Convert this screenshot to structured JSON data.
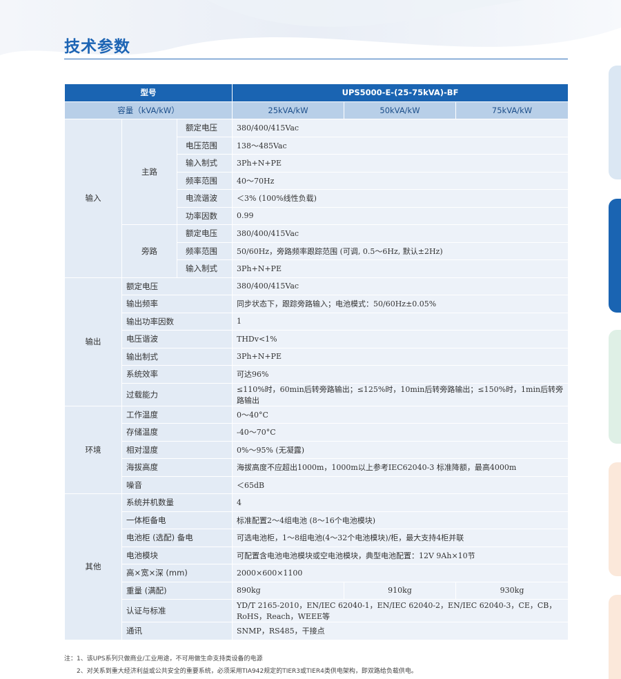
{
  "page_title": "技术参数",
  "table": {
    "header_model_label": "型号",
    "header_model_value": "UPS5000-E-(25-75kVA)-BF",
    "capacity_label": "容量（kVA/kW）",
    "capacities": [
      "25kVA/kW",
      "50kVA/kW",
      "75kVA/kW"
    ],
    "input": {
      "label": "输入",
      "main": {
        "label": "主路",
        "rows": [
          {
            "name": "额定电压",
            "value": "380/400/415Vac"
          },
          {
            "name": "电压范围",
            "value": "138～485Vac"
          },
          {
            "name": "输入制式",
            "value": "3Ph+N+PE"
          },
          {
            "name": "频率范围",
            "value": "40～70Hz"
          },
          {
            "name": "电流谐波",
            "value": "＜3% (100%线性负载)"
          },
          {
            "name": "功率因数",
            "value": "0.99"
          }
        ]
      },
      "bypass": {
        "label": "旁路",
        "rows": [
          {
            "name": "额定电压",
            "value": "380/400/415Vac"
          },
          {
            "name": "频率范围",
            "value": "50/60Hz，旁路频率跟踪范围 (可调, 0.5～6Hz, 默认±2Hz)"
          },
          {
            "name": "输入制式",
            "value": "3Ph+N+PE"
          }
        ]
      }
    },
    "output": {
      "label": "输出",
      "rows": [
        {
          "name": "额定电压",
          "value": "380/400/415Vac"
        },
        {
          "name": "输出频率",
          "value": "同步状态下，跟踪旁路输入；电池模式：50/60Hz±0.05%"
        },
        {
          "name": "输出功率因数",
          "value": "1"
        },
        {
          "name": "电压谐波",
          "value": "THDv<1%"
        },
        {
          "name": "输出制式",
          "value": "3Ph+N+PE"
        },
        {
          "name": "系统效率",
          "value": "可达96%"
        },
        {
          "name": "过载能力",
          "value": "≤110%时，60min后转旁路输出；≤125%时，10min后转旁路输出；≤150%时，1min后转旁路输出"
        }
      ]
    },
    "environment": {
      "label": "环境",
      "rows": [
        {
          "name": "工作温度",
          "value": "0～40°C"
        },
        {
          "name": "存储温度",
          "value": "-40～70°C"
        },
        {
          "name": "相对湿度",
          "value": "0%～95% (无凝露)"
        },
        {
          "name": "海拔高度",
          "value": "海拔高度不应超出1000m，1000m以上参考IEC62040-3 标准降额，最高4000m"
        },
        {
          "name": "噪音",
          "value": "＜65dB"
        }
      ]
    },
    "other": {
      "label": "其他",
      "rows": [
        {
          "name": "系统并机数量",
          "value": "4"
        },
        {
          "name": "一体柜备电",
          "value": "标准配置2～4组电池 (8～16个电池模块)"
        },
        {
          "name": "电池柜 (选配) 备电",
          "value": "可选电池柜，1～8组电池(4～32个电池模块)/柜，最大支持4柜并联"
        },
        {
          "name": "电池模块",
          "value": "可配置含电池电池模块或空电池模块，典型电池配置：12V 9Ah×10节"
        },
        {
          "name": "高×宽×深 (mm)",
          "value": "2000×600×1100"
        },
        {
          "name": "重量 (满配)",
          "values": [
            "890kg",
            "910kg",
            "930kg"
          ]
        },
        {
          "name": "认证与标准",
          "value": "YD/T 2165-2010，EN/IEC 62040-1，EN/IEC 62040-2，EN/IEC 62040-3，CE，CB，RoHS，Reach，WEEE等"
        },
        {
          "name": "通讯",
          "value": "SNMP，RS485，干接点"
        }
      ]
    }
  },
  "notes": [
    "注：1、该UPS系列只做商业/工业用途，不可用做生命支持类设备的电源",
    "2、对关系到重大经济利益或公共安全的重要系统，必须采用TIA942规定的TIER3或TIER4类供电架构，即双路给负载供电。"
  ],
  "colors": {
    "brand": "#1a64b2",
    "title": "#1c64b4",
    "subheader": "#b8cfe8",
    "cell": "#e3ebf5",
    "value_cell": "#edf2f9"
  }
}
